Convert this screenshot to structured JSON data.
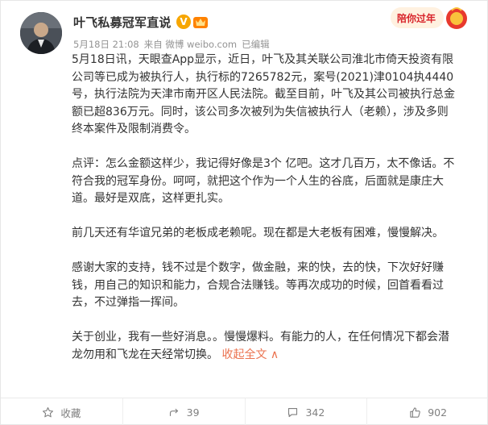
{
  "post": {
    "author": "叶飞私募冠军直说",
    "verified_badge": "V",
    "time": "5月18日 21:08",
    "source": "来自 微博 weibo.com",
    "edited": "已编辑",
    "promo_text": "陪你过年",
    "paragraphs": [
      "5月18日讯，天眼查App显示，近日，叶飞及其关联公司淮北市倚天投资有限公司等已成为被执行人，执行标的7265782元，案号(2021)津0104执4440号，执行法院为天津市南开区人民法院。截至目前，叶飞及其公司被执行总金额已超836万元。同时，该公司多次被列为失信被执行人（老赖），涉及多则终本案件及限制消费令。",
      "点评：怎么金额这样少，我记得好像是3个 亿吧。这才几百万，太不像话。不符合我的冠军身份。呵呵，就把这个作为一个人生的谷底，后面就是康庄大道。最好是双底，这样更扎实。",
      "前几天还有华谊兄弟的老板成老赖呢。现在都是大老板有困难，慢慢解决。",
      "感谢大家的支持，钱不过是个数字，做金融，来的快，去的快，下次好好赚钱，用自己的知识和能力，合规合法赚钱。等再次成功的时候，回首看看过去，不过弹指一挥间。",
      "关于创业，我有一些好消息。。慢慢爆料。有能力的人，在任何情况下都会潜龙勿用和飞龙在天经常切换。"
    ],
    "collapse_label": "收起全文",
    "collapse_arrow": "∧"
  },
  "actions": {
    "favorite": "收藏",
    "forward": "39",
    "comment": "342",
    "like": "902"
  },
  "colors": {
    "link": "#eb7350",
    "meta": "#939393",
    "badge": "#f7a600"
  },
  "icons": {
    "favorite": "star-icon",
    "forward": "forward-icon",
    "comment": "comment-icon",
    "like": "thumbs-up-icon",
    "member": "member-crown-icon"
  }
}
